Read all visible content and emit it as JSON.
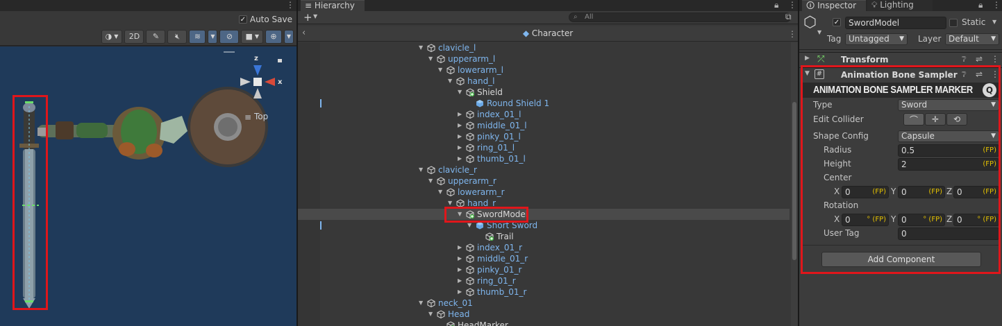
{
  "scene": {
    "auto_save_label": "Auto Save",
    "auto_save_checked": true,
    "mode_2d_label": "2D",
    "view_label": "Top",
    "gizmo_axis_x": "x",
    "gizmo_axis_z": "z"
  },
  "hierarchy": {
    "tab_label": "Hierarchy",
    "add_label": "+",
    "search_placeholder": "All",
    "prefab_title": "Character",
    "rows": [
      {
        "label": "clavicle_l",
        "depth": 0,
        "expanded": true,
        "icon": "cube-outline-icon",
        "color": "blue"
      },
      {
        "label": "upperarm_l",
        "depth": 1,
        "expanded": true,
        "icon": "cube-outline-icon",
        "color": "blue"
      },
      {
        "label": "lowerarm_l",
        "depth": 2,
        "expanded": true,
        "icon": "cube-outline-icon",
        "color": "blue"
      },
      {
        "label": "hand_l",
        "depth": 3,
        "expanded": true,
        "icon": "cube-outline-icon",
        "color": "blue"
      },
      {
        "label": "Shield",
        "depth": 4,
        "expanded": true,
        "icon": "cube-plus-icon",
        "color": "white"
      },
      {
        "label": "Round Shield 1",
        "depth": 5,
        "expanded": null,
        "icon": "prefab-cube-icon",
        "color": "blue",
        "marker": true
      },
      {
        "label": "index_01_l",
        "depth": 4,
        "expanded": false,
        "icon": "cube-outline-icon",
        "color": "blue"
      },
      {
        "label": "middle_01_l",
        "depth": 4,
        "expanded": false,
        "icon": "cube-outline-icon",
        "color": "blue"
      },
      {
        "label": "pinky_01_l",
        "depth": 4,
        "expanded": false,
        "icon": "cube-outline-icon",
        "color": "blue"
      },
      {
        "label": "ring_01_l",
        "depth": 4,
        "expanded": false,
        "icon": "cube-outline-icon",
        "color": "blue"
      },
      {
        "label": "thumb_01_l",
        "depth": 4,
        "expanded": false,
        "icon": "cube-outline-icon",
        "color": "blue"
      },
      {
        "label": "clavicle_r",
        "depth": 0,
        "expanded": true,
        "icon": "cube-outline-icon",
        "color": "blue"
      },
      {
        "label": "upperarm_r",
        "depth": 1,
        "expanded": true,
        "icon": "cube-outline-icon",
        "color": "blue"
      },
      {
        "label": "lowerarm_r",
        "depth": 2,
        "expanded": true,
        "icon": "cube-outline-icon",
        "color": "blue"
      },
      {
        "label": "hand_r",
        "depth": 3,
        "expanded": true,
        "icon": "cube-outline-icon",
        "color": "blue"
      },
      {
        "label": "SwordModel",
        "depth": 4,
        "expanded": true,
        "icon": "cube-plus-icon",
        "color": "white",
        "selected": true,
        "highlight": true
      },
      {
        "label": "Short Sword",
        "depth": 5,
        "expanded": true,
        "icon": "prefab-cube-icon",
        "color": "blue",
        "marker": true
      },
      {
        "label": "Trail",
        "depth": 6,
        "expanded": null,
        "icon": "cube-plus-icon",
        "color": "white"
      },
      {
        "label": "index_01_r",
        "depth": 4,
        "expanded": false,
        "icon": "cube-outline-icon",
        "color": "blue"
      },
      {
        "label": "middle_01_r",
        "depth": 4,
        "expanded": false,
        "icon": "cube-outline-icon",
        "color": "blue"
      },
      {
        "label": "pinky_01_r",
        "depth": 4,
        "expanded": false,
        "icon": "cube-outline-icon",
        "color": "blue"
      },
      {
        "label": "ring_01_r",
        "depth": 4,
        "expanded": false,
        "icon": "cube-outline-icon",
        "color": "blue"
      },
      {
        "label": "thumb_01_r",
        "depth": 4,
        "expanded": false,
        "icon": "cube-outline-icon",
        "color": "blue"
      },
      {
        "label": "neck_01",
        "depth": 0,
        "expanded": true,
        "icon": "cube-outline-icon",
        "color": "blue"
      },
      {
        "label": "Head",
        "depth": 1,
        "expanded": true,
        "icon": "cube-outline-icon",
        "color": "blue"
      },
      {
        "label": "HeadMarker",
        "depth": 2,
        "expanded": null,
        "icon": "cube-plus-icon",
        "color": "white"
      }
    ]
  },
  "inspector": {
    "tab_label": "Inspector",
    "lighting_tab_label": "Lighting",
    "object_name": "SwordModel",
    "active_checked": true,
    "static_label": "Static",
    "tag_label": "Tag",
    "tag_value": "Untagged",
    "layer_label": "Layer",
    "layer_value": "Default",
    "transform_title": "Transform",
    "component_title": "Animation Bone Sampler Marker",
    "component_title_visible": "Animation Bone Sampler Mar",
    "banner_title": "ANIMATION BONE SAMPLER MARKER",
    "fp_label": "(FP)",
    "deg_fp_label": "° (FP)",
    "type_label": "Type",
    "type_value": "Sword",
    "edit_collider_label": "Edit Collider",
    "shape_config_label": "Shape Config",
    "shape_value": "Capsule",
    "radius_label": "Radius",
    "radius_value": "0.5",
    "height_label": "Height",
    "height_value": "2",
    "center_label": "Center",
    "center": {
      "x": "0",
      "y": "0",
      "z": "0"
    },
    "rotation_label": "Rotation",
    "rotation": {
      "x": "0",
      "y": "0",
      "z": "0"
    },
    "axis_x": "X",
    "axis_y": "Y",
    "axis_z": "Z",
    "user_tag_label": "User Tag",
    "user_tag_value": "0",
    "add_component_label": "Add Component"
  },
  "colors": {
    "highlight_red": "#e0161b",
    "fp_yellow": "#e6c200",
    "link_blue": "#7fb6ee",
    "viewport_blue": "#1f3a5a"
  }
}
